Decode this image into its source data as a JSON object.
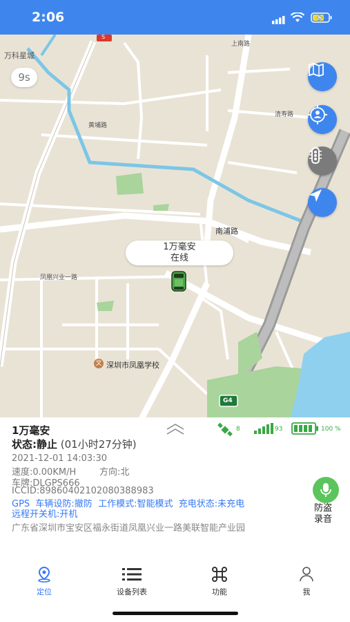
{
  "status_bar": {
    "time": "2:06"
  },
  "map": {
    "countdown": "9s",
    "vehicle_bubble": {
      "name": "1万毫安",
      "status": "在线"
    },
    "labels": {
      "wanke": "万科星城",
      "shangnan": "上南路",
      "huangpu": "黄埔路",
      "qingshou": "清寿路",
      "nanpu": "南浦路",
      "fenghuang_road": "凤凰兴业一路",
      "school": "深圳市凤凰学校",
      "highway_g4": "G4",
      "s_badge": "S"
    }
  },
  "info": {
    "device_name": "1万毫安",
    "state_label": "状态:静止",
    "state_duration": "(01小时27分钟)",
    "satellites": "8",
    "signal": "93",
    "battery": "100 %",
    "timestamp": "2021-12-01 14:03:30",
    "speed": "速度:0.00KM/H",
    "direction": "方向:北",
    "plate": "车牌:DLGPS666",
    "iccid": "ICCID:89860402102080388983",
    "status_line1": "GPS  车辆设防:撤防  工作模式:智能模式  充电状态:未充电",
    "status_line2": "远程开关机:开机",
    "address": "广东省深圳市宝安区福永街道凤凰兴业一路美联智能产业园",
    "record_label1": "防盗",
    "record_label2": "录音"
  },
  "tabs": [
    {
      "label": "定位"
    },
    {
      "label": "设备列表"
    },
    {
      "label": "功能"
    },
    {
      "label": "我"
    }
  ],
  "colors": {
    "accent": "#3e86ee",
    "tab_active": "#3478f6",
    "record_green": "#5cc45c"
  }
}
